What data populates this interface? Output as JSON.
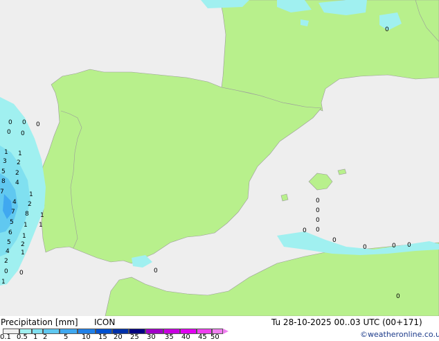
{
  "header": {
    "title": "Precipitation [mm]",
    "model": "ICON",
    "datetime": "Tu 28-10-2025 00..03 UTC (00+171)",
    "credit": "©weatheronline.co.uk"
  },
  "legend": {
    "labels": [
      "0.1",
      "0.5",
      "1",
      "2",
      "5",
      "10",
      "15",
      "20",
      "25",
      "30",
      "35",
      "40",
      "45",
      "50"
    ],
    "colors": [
      "#f0f0f0",
      "#a0f0f0",
      "#80e0f0",
      "#60c8f0",
      "#40a8f0",
      "#2080e8",
      "#0050d0",
      "#0030a8",
      "#000080",
      "#a000c8",
      "#c800e0",
      "#e000f0",
      "#f040f0",
      "#f080f0"
    ]
  },
  "map": {
    "sea_color": "#eeeeee",
    "land_color": "#b8f08c",
    "border_color": "#9a9a9a",
    "rain_light": "#a0f0f0",
    "rain_mid": "#80e0f0",
    "rain_heavy": "#60c8f0",
    "values": [
      "0",
      "0",
      "0",
      "0",
      "0",
      "1",
      "0",
      "0",
      "0",
      "0",
      "0",
      "0",
      "0",
      "0",
      "0",
      "1",
      "1",
      "3",
      "2",
      "5",
      "2",
      "8",
      "4",
      "7",
      "1",
      "4",
      "2",
      "7",
      "8",
      "5",
      "1",
      "6",
      "1",
      "5",
      "1",
      "4",
      "1",
      "2",
      "1",
      "2",
      "0",
      "1",
      "0",
      "0",
      "0",
      "0",
      "0",
      "0",
      "0",
      "0",
      "0",
      "0",
      "0",
      "0",
      "0"
    ]
  }
}
